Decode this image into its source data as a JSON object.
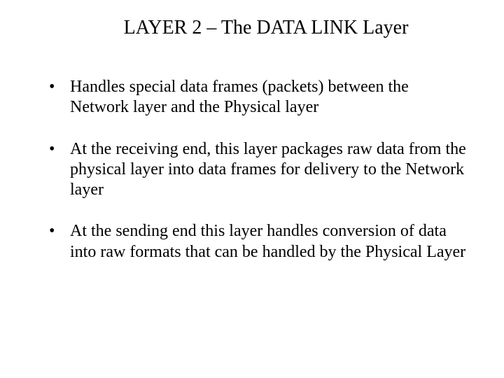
{
  "title": "LAYER 2 – The DATA LINK Layer",
  "bullets": {
    "b0": "Handles special data frames (packets) between the Network layer and the Physical layer",
    "b1": "At the receiving end, this layer packages raw data from the physical layer into data frames for delivery to the Network layer",
    "b2": "At the sending end this layer handles conversion of data into raw formats that can be handled by the Physical Layer"
  }
}
